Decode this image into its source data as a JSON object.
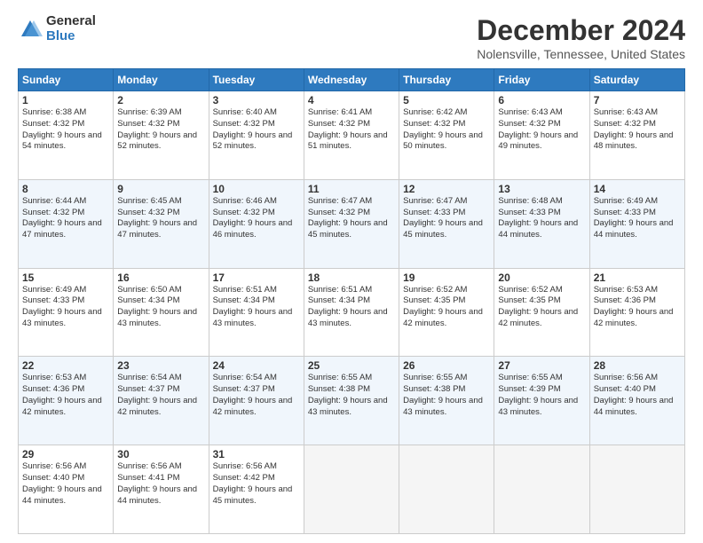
{
  "logo": {
    "general": "General",
    "blue": "Blue"
  },
  "title": "December 2024",
  "subtitle": "Nolensville, Tennessee, United States",
  "headers": [
    "Sunday",
    "Monday",
    "Tuesday",
    "Wednesday",
    "Thursday",
    "Friday",
    "Saturday"
  ],
  "weeks": [
    [
      {
        "day": "1",
        "sunrise": "6:38 AM",
        "sunset": "4:32 PM",
        "daylight": "9 hours and 54 minutes."
      },
      {
        "day": "2",
        "sunrise": "6:39 AM",
        "sunset": "4:32 PM",
        "daylight": "9 hours and 52 minutes."
      },
      {
        "day": "3",
        "sunrise": "6:40 AM",
        "sunset": "4:32 PM",
        "daylight": "9 hours and 52 minutes."
      },
      {
        "day": "4",
        "sunrise": "6:41 AM",
        "sunset": "4:32 PM",
        "daylight": "9 hours and 51 minutes."
      },
      {
        "day": "5",
        "sunrise": "6:42 AM",
        "sunset": "4:32 PM",
        "daylight": "9 hours and 50 minutes."
      },
      {
        "day": "6",
        "sunrise": "6:43 AM",
        "sunset": "4:32 PM",
        "daylight": "9 hours and 49 minutes."
      },
      {
        "day": "7",
        "sunrise": "6:43 AM",
        "sunset": "4:32 PM",
        "daylight": "9 hours and 48 minutes."
      }
    ],
    [
      {
        "day": "8",
        "sunrise": "6:44 AM",
        "sunset": "4:32 PM",
        "daylight": "9 hours and 47 minutes."
      },
      {
        "day": "9",
        "sunrise": "6:45 AM",
        "sunset": "4:32 PM",
        "daylight": "9 hours and 47 minutes."
      },
      {
        "day": "10",
        "sunrise": "6:46 AM",
        "sunset": "4:32 PM",
        "daylight": "9 hours and 46 minutes."
      },
      {
        "day": "11",
        "sunrise": "6:47 AM",
        "sunset": "4:32 PM",
        "daylight": "9 hours and 45 minutes."
      },
      {
        "day": "12",
        "sunrise": "6:47 AM",
        "sunset": "4:33 PM",
        "daylight": "9 hours and 45 minutes."
      },
      {
        "day": "13",
        "sunrise": "6:48 AM",
        "sunset": "4:33 PM",
        "daylight": "9 hours and 44 minutes."
      },
      {
        "day": "14",
        "sunrise": "6:49 AM",
        "sunset": "4:33 PM",
        "daylight": "9 hours and 44 minutes."
      }
    ],
    [
      {
        "day": "15",
        "sunrise": "6:49 AM",
        "sunset": "4:33 PM",
        "daylight": "9 hours and 43 minutes."
      },
      {
        "day": "16",
        "sunrise": "6:50 AM",
        "sunset": "4:34 PM",
        "daylight": "9 hours and 43 minutes."
      },
      {
        "day": "17",
        "sunrise": "6:51 AM",
        "sunset": "4:34 PM",
        "daylight": "9 hours and 43 minutes."
      },
      {
        "day": "18",
        "sunrise": "6:51 AM",
        "sunset": "4:34 PM",
        "daylight": "9 hours and 43 minutes."
      },
      {
        "day": "19",
        "sunrise": "6:52 AM",
        "sunset": "4:35 PM",
        "daylight": "9 hours and 42 minutes."
      },
      {
        "day": "20",
        "sunrise": "6:52 AM",
        "sunset": "4:35 PM",
        "daylight": "9 hours and 42 minutes."
      },
      {
        "day": "21",
        "sunrise": "6:53 AM",
        "sunset": "4:36 PM",
        "daylight": "9 hours and 42 minutes."
      }
    ],
    [
      {
        "day": "22",
        "sunrise": "6:53 AM",
        "sunset": "4:36 PM",
        "daylight": "9 hours and 42 minutes."
      },
      {
        "day": "23",
        "sunrise": "6:54 AM",
        "sunset": "4:37 PM",
        "daylight": "9 hours and 42 minutes."
      },
      {
        "day": "24",
        "sunrise": "6:54 AM",
        "sunset": "4:37 PM",
        "daylight": "9 hours and 42 minutes."
      },
      {
        "day": "25",
        "sunrise": "6:55 AM",
        "sunset": "4:38 PM",
        "daylight": "9 hours and 43 minutes."
      },
      {
        "day": "26",
        "sunrise": "6:55 AM",
        "sunset": "4:38 PM",
        "daylight": "9 hours and 43 minutes."
      },
      {
        "day": "27",
        "sunrise": "6:55 AM",
        "sunset": "4:39 PM",
        "daylight": "9 hours and 43 minutes."
      },
      {
        "day": "28",
        "sunrise": "6:56 AM",
        "sunset": "4:40 PM",
        "daylight": "9 hours and 44 minutes."
      }
    ],
    [
      {
        "day": "29",
        "sunrise": "6:56 AM",
        "sunset": "4:40 PM",
        "daylight": "9 hours and 44 minutes."
      },
      {
        "day": "30",
        "sunrise": "6:56 AM",
        "sunset": "4:41 PM",
        "daylight": "9 hours and 44 minutes."
      },
      {
        "day": "31",
        "sunrise": "6:56 AM",
        "sunset": "4:42 PM",
        "daylight": "9 hours and 45 minutes."
      },
      null,
      null,
      null,
      null
    ]
  ],
  "labels": {
    "sunrise": "Sunrise:",
    "sunset": "Sunset:",
    "daylight": "Daylight:"
  }
}
